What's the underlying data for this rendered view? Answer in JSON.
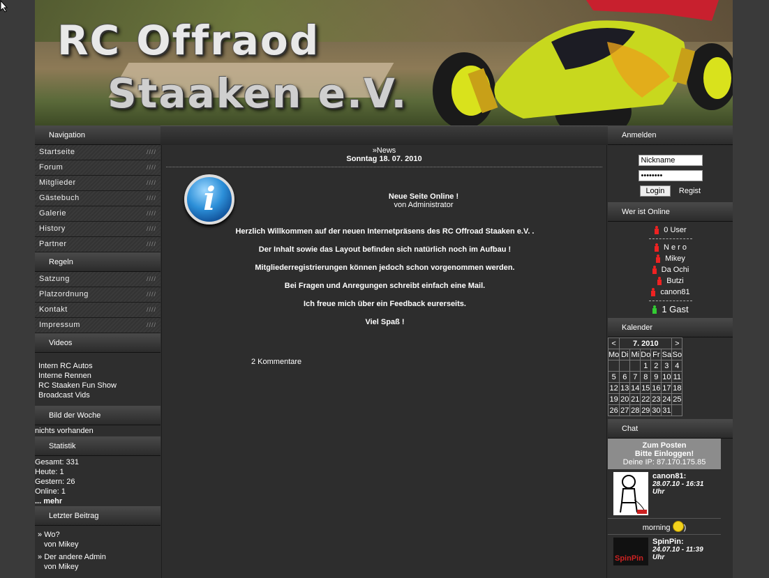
{
  "banner": {
    "line1": "RC Offraod",
    "line2": "Staaken e.V."
  },
  "nav": {
    "title": "Navigation",
    "items": [
      "Startseite",
      "Forum",
      "Mitglieder",
      "Gästebuch",
      "Galerie",
      "History",
      "Partner"
    ],
    "rules_title": "Regeln",
    "rules_items": [
      "Satzung",
      "Platzordnung",
      "Kontakt",
      "Impressum"
    ],
    "slash": "////"
  },
  "videos": {
    "title": "Videos",
    "links": [
      "Intern RC Autos",
      "Interne Rennen",
      "RC Staaken Fun Show",
      "Broadcast Vids"
    ]
  },
  "bild": {
    "title": "Bild der Woche",
    "text": "nichts vorhanden"
  },
  "statistik": {
    "title": "Statistik",
    "gesamt": "Gesamt: 331",
    "heute": "Heute: 1",
    "gestern": "Gestern: 26",
    "online": "Online: 1",
    "mehr": "... mehr"
  },
  "letzter": {
    "title": "Letzter Beitrag",
    "posts": [
      {
        "topic": "Wo?",
        "by": "von Mikey"
      },
      {
        "topic": "Der andere Admin",
        "by": "von Mikey"
      }
    ]
  },
  "news": {
    "section": "»News",
    "date": "Sonntag 18. 07. 2010",
    "title": "Neue Seite Online !",
    "author": "von Administrator",
    "paragraphs": [
      "Herzlich Willkommen auf der neuen Internetpräsens des RC Offroad Staaken e.V. .",
      "Der Inhalt sowie das Layout befinden sich natürlich noch im Aufbau !",
      "Mitgliederregistrierungen können jedoch schon vorgenommen werden.",
      "Bei Fragen und Anregungen schreibt einfach eine Mail.",
      "Ich freue mich über ein Feedback eurerseits.",
      "Viel Spaß !"
    ],
    "comments": "2 Kommentare"
  },
  "login": {
    "title": "Anmelden",
    "nickname": "Nickname",
    "password": "••••••••",
    "login_btn": "Login",
    "register": "Regist"
  },
  "online": {
    "title": "Wer ist Online",
    "count": "0 User",
    "users": [
      "N e r o",
      "Mikey",
      "Da Ochi",
      "Butzi",
      "canon81"
    ],
    "guest": "1 Gast"
  },
  "kalender": {
    "title": "Kalender",
    "prev": "<",
    "next": ">",
    "month": "7. 2010",
    "days": [
      "Mo",
      "Di",
      "Mi",
      "Do",
      "Fr",
      "Sa",
      "So"
    ],
    "weeks": [
      [
        "",
        "",
        "",
        "1",
        "2",
        "3",
        "4"
      ],
      [
        "5",
        "6",
        "7",
        "8",
        "9",
        "10",
        "11"
      ],
      [
        "12",
        "13",
        "14",
        "15",
        "16",
        "17",
        "18"
      ],
      [
        "19",
        "20",
        "21",
        "22",
        "23",
        "24",
        "25"
      ],
      [
        "26",
        "27",
        "28",
        "29",
        "30",
        "31",
        ""
      ]
    ]
  },
  "chat": {
    "title": "Chat",
    "notice1": "Zum Posten",
    "notice2": "Bitte Einloggen!",
    "ip": "Deine IP: 87.170.175.85",
    "messages": [
      {
        "name": "canon81:",
        "time": "28.07.10 - 16:31 Uhr",
        "text": "morning"
      },
      {
        "name": "SpinPin:",
        "time": "24.07.10 - 11:39 Uhr",
        "avatar_text": "SpinPin"
      }
    ]
  },
  "colors": {
    "bg": "#3a3a3a",
    "panel": "#2e2e2e",
    "chat_notice": "#8c8c8c",
    "online_icon": "#e22",
    "guest_icon": "#3c3"
  }
}
